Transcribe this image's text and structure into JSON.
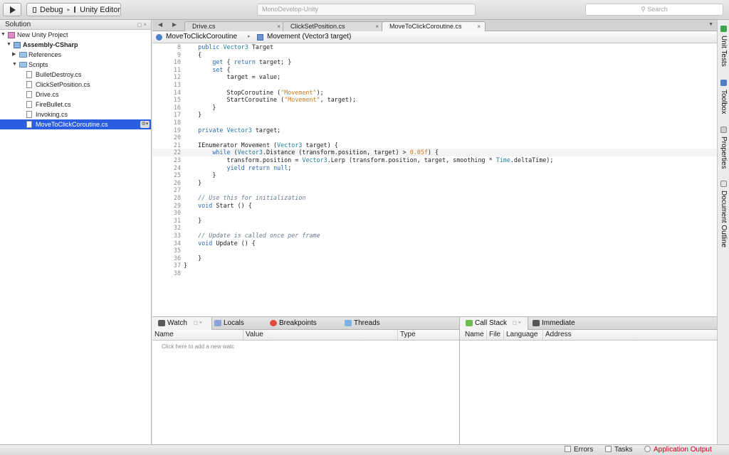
{
  "toolbar": {
    "run_icon": "play-icon",
    "config_label": "Debug",
    "config_separator": "▸",
    "target_label": "Unity Editor",
    "window_title": "MonoDevelop-Unity",
    "search_placeholder": "Search"
  },
  "solution": {
    "title": "Solution",
    "pad_controls": "◻ ×",
    "items": [
      {
        "label": "New Unity Project",
        "kind": "solution",
        "icon": "solution-icon"
      },
      {
        "label": "Assembly-CSharp",
        "kind": "project",
        "icon": "project-icon"
      },
      {
        "label": "References",
        "kind": "folder",
        "icon": "folder-icon"
      },
      {
        "label": "Scripts",
        "kind": "folder",
        "icon": "folder-icon"
      },
      {
        "label": "BulletDestroy.cs",
        "kind": "file",
        "icon": "cs-file-icon"
      },
      {
        "label": "ClickSetPosition.cs",
        "kind": "file",
        "icon": "cs-file-icon"
      },
      {
        "label": "Drive.cs",
        "kind": "file",
        "icon": "cs-file-icon"
      },
      {
        "label": "FireBullet.cs",
        "kind": "file",
        "icon": "cs-file-icon"
      },
      {
        "label": "Invoking.cs",
        "kind": "file",
        "icon": "cs-file-icon"
      },
      {
        "label": "MoveToClickCoroutine.cs",
        "kind": "file",
        "icon": "cs-file-icon",
        "selected": true
      }
    ],
    "selected_gear": "⚙▾"
  },
  "tabs": [
    {
      "label": "Drive.cs",
      "active": false
    },
    {
      "label": "ClickSetPosition.cs",
      "active": false
    },
    {
      "label": "MoveToClickCoroutine.cs",
      "active": true
    }
  ],
  "tab_close": "×",
  "breadcrumb": {
    "class_name": "MoveToClickCoroutine",
    "member_name": "Movement (Vector3 target)",
    "separator": "▸"
  },
  "editor": {
    "current_line": "22",
    "lines": [
      {
        "n": "8",
        "text": "    public Vector3 Target"
      },
      {
        "n": "9",
        "text": "    {"
      },
      {
        "n": "10",
        "text": "        get { return target; }"
      },
      {
        "n": "11",
        "text": "        set {"
      },
      {
        "n": "12",
        "text": "            target = value;"
      },
      {
        "n": "13",
        "text": ""
      },
      {
        "n": "14",
        "text": "            StopCoroutine (\"Movement\");"
      },
      {
        "n": "15",
        "text": "            StartCoroutine (\"Movement\", target);"
      },
      {
        "n": "16",
        "text": "        }"
      },
      {
        "n": "17",
        "text": "    }"
      },
      {
        "n": "18",
        "text": ""
      },
      {
        "n": "19",
        "text": "    private Vector3 target;"
      },
      {
        "n": "20",
        "text": ""
      },
      {
        "n": "21",
        "text": "    IEnumerator Movement (Vector3 target) {"
      },
      {
        "n": "22",
        "text": "        while (Vector3.Distance (transform.position, target) > 0.05f) {"
      },
      {
        "n": "23",
        "text": "            transform.position = Vector3.Lerp (transform.position, target, smoothing * Time.deltaTime);"
      },
      {
        "n": "24",
        "text": "            yield return null;"
      },
      {
        "n": "25",
        "text": "        }"
      },
      {
        "n": "26",
        "text": "    }"
      },
      {
        "n": "27",
        "text": ""
      },
      {
        "n": "28",
        "text": "    // Use this for initialization"
      },
      {
        "n": "29",
        "text": "    void Start () {"
      },
      {
        "n": "30",
        "text": ""
      },
      {
        "n": "31",
        "text": "    }"
      },
      {
        "n": "32",
        "text": ""
      },
      {
        "n": "33",
        "text": "    // Update is called once per frame"
      },
      {
        "n": "34",
        "text": "    void Update () {"
      },
      {
        "n": "35",
        "text": ""
      },
      {
        "n": "36",
        "text": "    }"
      },
      {
        "n": "37",
        "text": "}"
      },
      {
        "n": "38",
        "text": ""
      }
    ]
  },
  "syntax_colors": {
    "keyword": "#2b6cb0",
    "string": "#d27b1f",
    "comment": "#6b7a8f",
    "type": "#1d7d9e",
    "text": "#222222"
  },
  "watch_pad": {
    "tabs": [
      {
        "label": "Watch",
        "icon": "binoculars-icon",
        "active": true,
        "controls": "◻ ×"
      },
      {
        "label": "Locals",
        "icon": "locals-icon",
        "active": false
      },
      {
        "label": "Breakpoints",
        "icon": "breakpoints-icon",
        "active": false
      },
      {
        "label": "Threads",
        "icon": "threads-icon",
        "active": false
      }
    ],
    "columns": [
      "Name",
      "Value",
      "Type"
    ],
    "hint": "Click here to add a new watc"
  },
  "callstack_pad": {
    "tabs": [
      {
        "label": "Call Stack",
        "icon": "callstack-icon",
        "active": true,
        "controls": "◻ ×"
      },
      {
        "label": "Immediate",
        "icon": "immediate-icon",
        "active": false
      }
    ],
    "columns": [
      "Name",
      "File",
      "Language",
      "Address"
    ]
  },
  "side_dock": [
    {
      "label": "Unit Tests",
      "icon": "unit-tests-icon"
    },
    {
      "label": "Toolbox",
      "icon": "toolbox-icon"
    },
    {
      "label": "Properties",
      "icon": "properties-icon"
    },
    {
      "label": "Document Outline",
      "icon": "document-outline-icon"
    }
  ],
  "status_bar": {
    "errors": "Errors",
    "tasks": "Tasks",
    "app_output": "Application Output",
    "app_output_color": "#d0021b"
  }
}
